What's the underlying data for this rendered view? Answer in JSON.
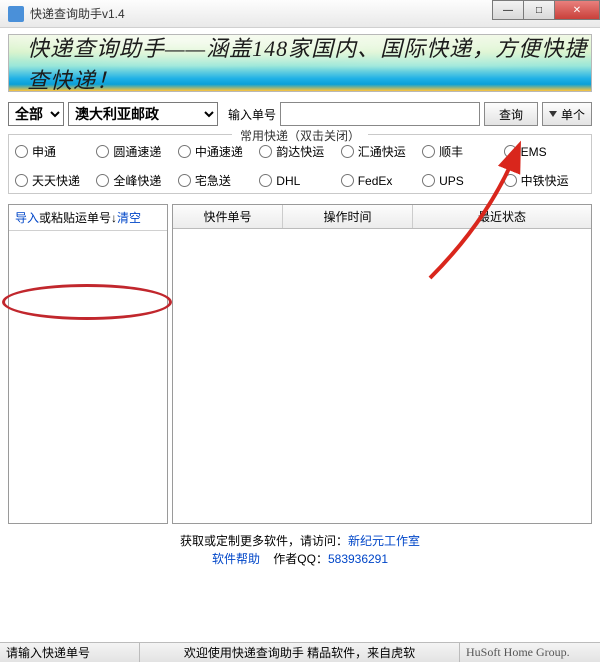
{
  "window": {
    "title": "快递查询助手v1.4"
  },
  "banner": {
    "text": "快递查询助手——涵盖148家国内、国际快递，方便快捷查快递！"
  },
  "search": {
    "category": "全部",
    "company": "澳大利亚邮政",
    "input_label": "输入单号",
    "query_button": "查询",
    "single_button": "单个"
  },
  "common": {
    "legend": "常用快递（双击关闭）",
    "items": [
      "申通",
      "圆通速递",
      "中通速递",
      "韵达快运",
      "汇通快运",
      "顺丰",
      "EMS",
      "天天快递",
      "全峰快递",
      "宅急送",
      "DHL",
      "FedEx",
      "UPS",
      "中铁快运"
    ]
  },
  "left": {
    "import": "导入",
    "mid": "或粘贴运单号↓",
    "clear": "清空"
  },
  "table": {
    "col1": "快件单号",
    "col2": "操作时间",
    "col3": "最近状态"
  },
  "footer": {
    "line1_prefix": "获取或定制更多软件，请访问：",
    "link1": "新纪元工作室",
    "help": "软件帮助",
    "author_label": "作者QQ：",
    "qq": "583936291"
  },
  "status": {
    "hint": "请输入快递单号",
    "center": "欢迎使用快递查询助手  精品软件，来自虎软",
    "group": "HuSoft Home Group."
  }
}
